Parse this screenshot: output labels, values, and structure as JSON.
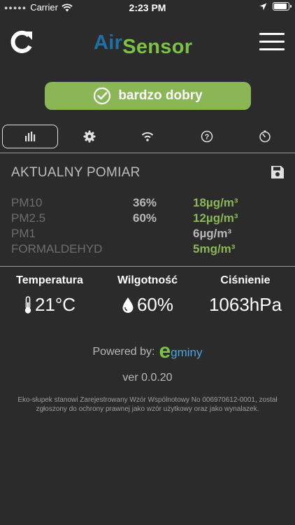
{
  "status_bar": {
    "carrier": "Carrier",
    "time": "2:23 PM",
    "battery_level": 0.95
  },
  "header": {
    "logo_air": "Air",
    "logo_sensor": "Sensor"
  },
  "quality": {
    "label": "bardzo dobry",
    "color": "#8bb655"
  },
  "tabs": [
    {
      "icon": "bar-chart-icon",
      "active": true
    },
    {
      "icon": "gear-icon",
      "active": false
    },
    {
      "icon": "wifi-icon",
      "active": false
    },
    {
      "icon": "help-icon",
      "active": false
    },
    {
      "icon": "timer-icon",
      "active": false
    }
  ],
  "measurement": {
    "title": "AKTUALNY POMIAR",
    "rows": [
      {
        "name": "PM10",
        "percent": "36%",
        "value": "18µg/m³"
      },
      {
        "name": "PM2.5",
        "percent": "60%",
        "value": "12µg/m³"
      },
      {
        "name": "PM1",
        "percent": "",
        "value": "6µg/m³"
      },
      {
        "name": "FORMALDEHYD",
        "percent": "",
        "value": "5mg/m³"
      }
    ]
  },
  "environment": {
    "temperature_label": "Temperatura",
    "temperature_value": "21°C",
    "humidity_label": "Wilgotność",
    "humidity_value": "60%",
    "pressure_label": "Ciśnienie",
    "pressure_value": "1063hPa"
  },
  "footer": {
    "powered_by": "Powered by:",
    "brand_e": "e",
    "brand_rest": "gminy",
    "version": "ver 0.0.20",
    "legal": "Eko-słupek stanowi Zarejestrowany Wzór Wspólnotowy No 006970612-0001, został zgłoszony do ochrony prawnej jako wzór użytkowy oraz jako wynalazek."
  },
  "colors": {
    "accent_green": "#8bb655",
    "logo_blue": "#1f6fa8",
    "background": "#2b2b2b"
  }
}
